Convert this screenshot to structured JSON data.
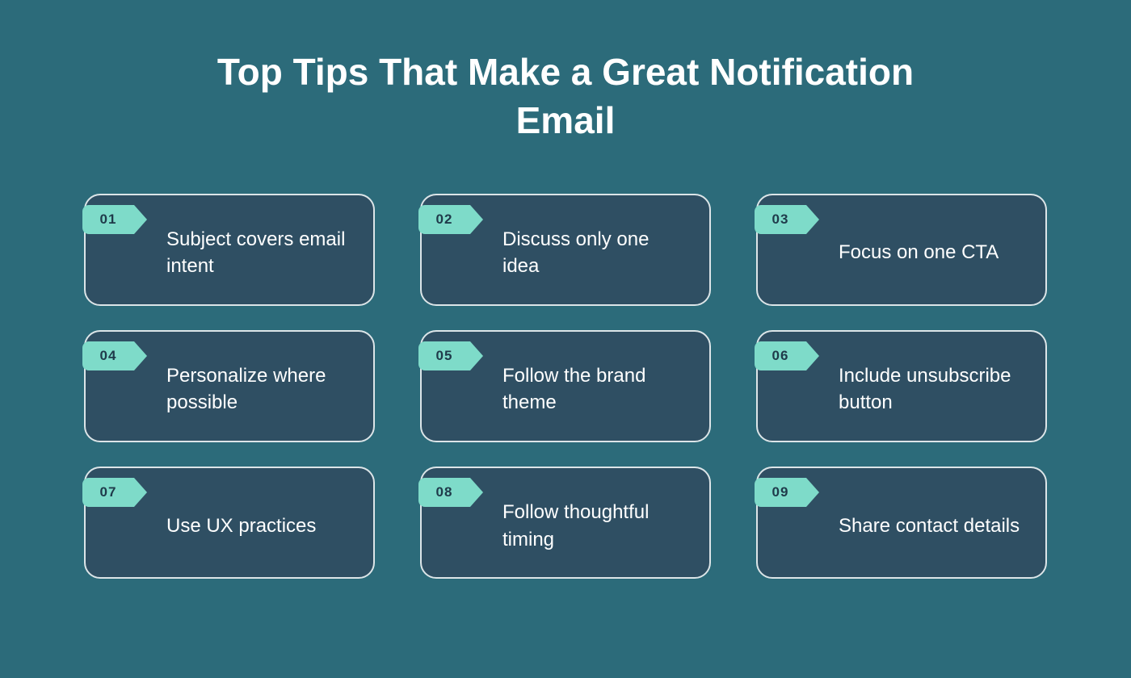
{
  "title": "Top Tips That Make a Great Notification Email",
  "tips": [
    {
      "num": "01",
      "text": "Subject covers email intent"
    },
    {
      "num": "02",
      "text": "Discuss only one idea"
    },
    {
      "num": "03",
      "text": "Focus on one CTA"
    },
    {
      "num": "04",
      "text": "Personalize where possible"
    },
    {
      "num": "05",
      "text": "Follow the brand theme"
    },
    {
      "num": "06",
      "text": "Include unsubscribe button"
    },
    {
      "num": "07",
      "text": "Use UX practices"
    },
    {
      "num": "08",
      "text": "Follow thoughtful timing"
    },
    {
      "num": "09",
      "text": "Share contact details"
    }
  ],
  "colors": {
    "background": "#2c6b7a",
    "card_bg": "#2f4f63",
    "card_border": "#dce5e8",
    "badge": "#7edbc9",
    "text": "#ffffff"
  }
}
